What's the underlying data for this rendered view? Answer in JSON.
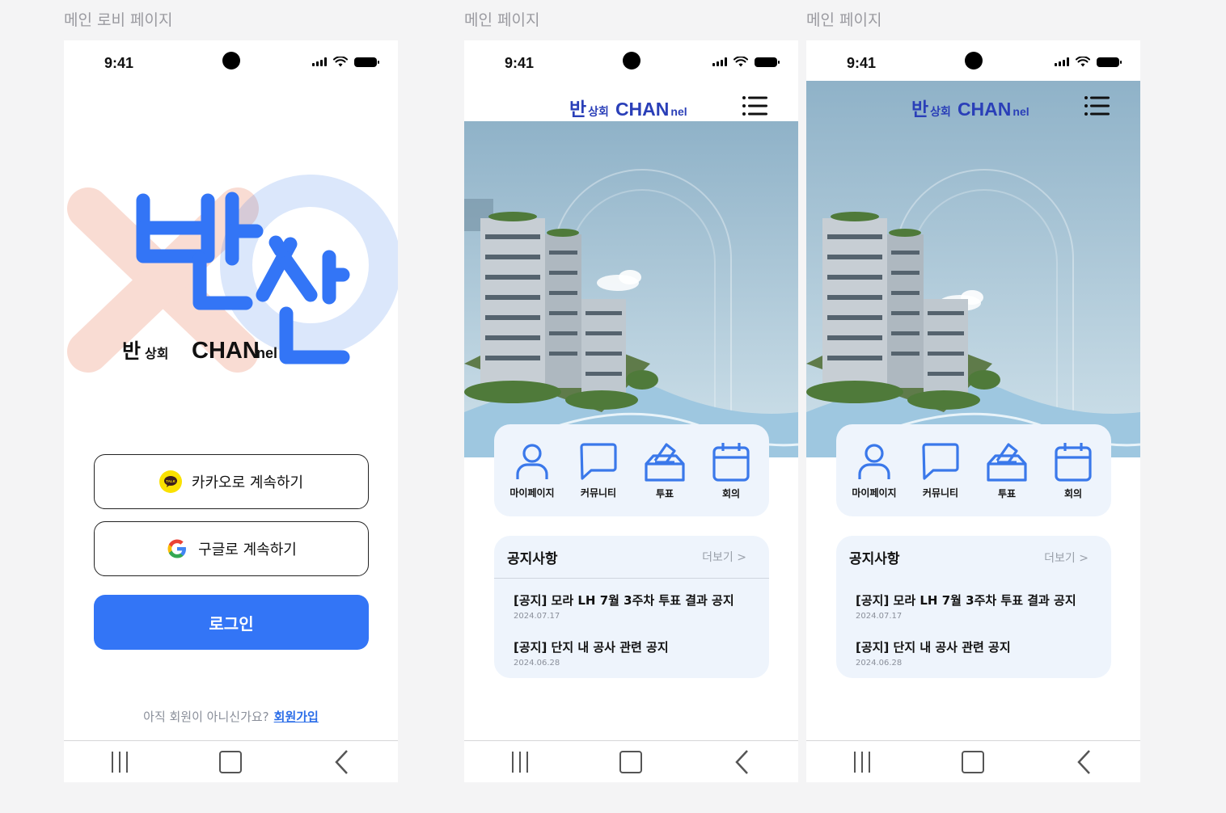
{
  "frames": {
    "lobby_label": "메인 로비 페이지",
    "main1_label": "메인 페이지",
    "main2_label": "메인 페이지"
  },
  "status_bar": {
    "time": "9:41"
  },
  "lobby": {
    "logo_big": "반찬",
    "logo_small_ban": "반",
    "logo_small_sanghoe": "상회",
    "logo_small_chan": "CHAN",
    "logo_small_nel": "nel",
    "kakao_label": "카카오로 계속하기",
    "kakao_badge": "TALK",
    "google_label": "구글로 계속하기",
    "login_label": "로그인",
    "signup_prompt": "아직 회원이 아니신가요?",
    "signup_link": "회원가입"
  },
  "main": {
    "brand_ban": "반",
    "brand_sanghoe": "상회",
    "brand_chan": "CHAN",
    "brand_nel": "nel",
    "quick_menu": [
      "마이페이지",
      "커뮤니티",
      "투표",
      "회의"
    ],
    "notice_title": "공지사항",
    "notice_more": "더보기 >",
    "notices": [
      {
        "title": "[공지] 모라 LH 7월 3주차 투표 결과 공지",
        "date": "2024.07.17"
      },
      {
        "title": "[공지] 단지 내 공사 관련 공지",
        "date": "2024.06.28"
      }
    ]
  },
  "colors": {
    "primary": "#3375f6",
    "brand_navy": "#2a3fb8",
    "card_bg": "#eef4fc",
    "kakao_yellow": "#fae100"
  }
}
